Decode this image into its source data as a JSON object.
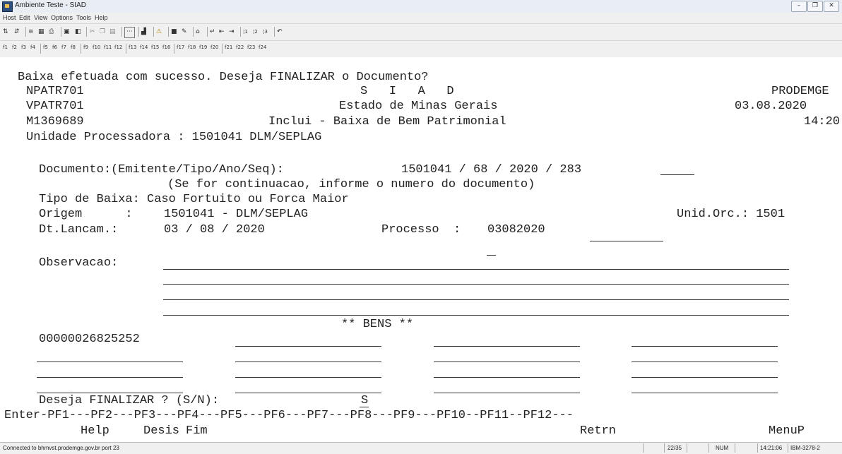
{
  "window": {
    "title": "Ambiente Teste - SIAD"
  },
  "menu": [
    "Host",
    "Edit",
    "View",
    "Options",
    "Tools",
    "Help"
  ],
  "toolbar2": {
    "pf_keys": [
      "f1",
      "f2",
      "f3",
      "f4",
      "f5",
      "f6",
      "f7",
      "f8",
      "f9",
      "f10",
      "f11",
      "f12",
      "f13",
      "f14",
      "f15",
      "f16",
      "f17",
      "f18",
      "f19",
      "f20",
      "f21",
      "f22",
      "f23",
      "f24"
    ]
  },
  "screen": {
    "message": "Baixa efetuada com sucesso. Deseja FINALIZAR o Documento?",
    "header": {
      "program1": "NPATR701",
      "system_title": "S   I   A   D",
      "org": "PRODEMGE",
      "program2": "VPATR701",
      "state": "Estado de Minas Gerais",
      "date": "03.08.2020",
      "user": "M1369689",
      "screen_title": "Inclui - Baixa de Bem Patrimonial",
      "time": "14:20",
      "unit_line": "Unidade Processadora : 1501041 DLM/SEPLAG"
    },
    "documento": {
      "label": "Documento:(Emitente/Tipo/Ano/Seq):",
      "value": "1501041 / 68 / 2020 / 283",
      "hint": "(Se for continuacao, informe o numero do documento)"
    },
    "tipo_baixa": "Tipo de Baixa: Caso Fortuito ou Forca Maior",
    "origem": {
      "label": "Origem      :",
      "value": "1501041 - DLM/SEPLAG"
    },
    "unid_orc": "Unid.Orc.: 1501",
    "dt_lancam": {
      "label": "Dt.Lancam.:",
      "value": "03 / 08 / 2020"
    },
    "processo": {
      "label": "Processo  :",
      "value": "03082020"
    },
    "observacao_label": "Observacao:",
    "bens_title": "** BENS **",
    "bens": [
      "00000026825252",
      "",
      "",
      "",
      "",
      "",
      "",
      "",
      "",
      "",
      "",
      ""
    ],
    "finalizar": {
      "label": "Deseja FINALIZAR ? (S/N):",
      "value": "S"
    },
    "pf_line": "Enter-PF1---PF2---PF3---PF4---PF5---PF6---PF7---PF8---PF9---PF10--PF11--PF12---",
    "pf_labels": {
      "help": "Help",
      "desis": "Desis",
      "fim": "Fim",
      "retrn": "Retrn",
      "menup": "MenuP"
    }
  },
  "status": {
    "connection": "Connected to bhmvst.prodemge.gov.br port 23",
    "cursor": "22/35",
    "num": "NUM",
    "clock": "14:21:06",
    "terminal": "IBM-3278-2"
  }
}
